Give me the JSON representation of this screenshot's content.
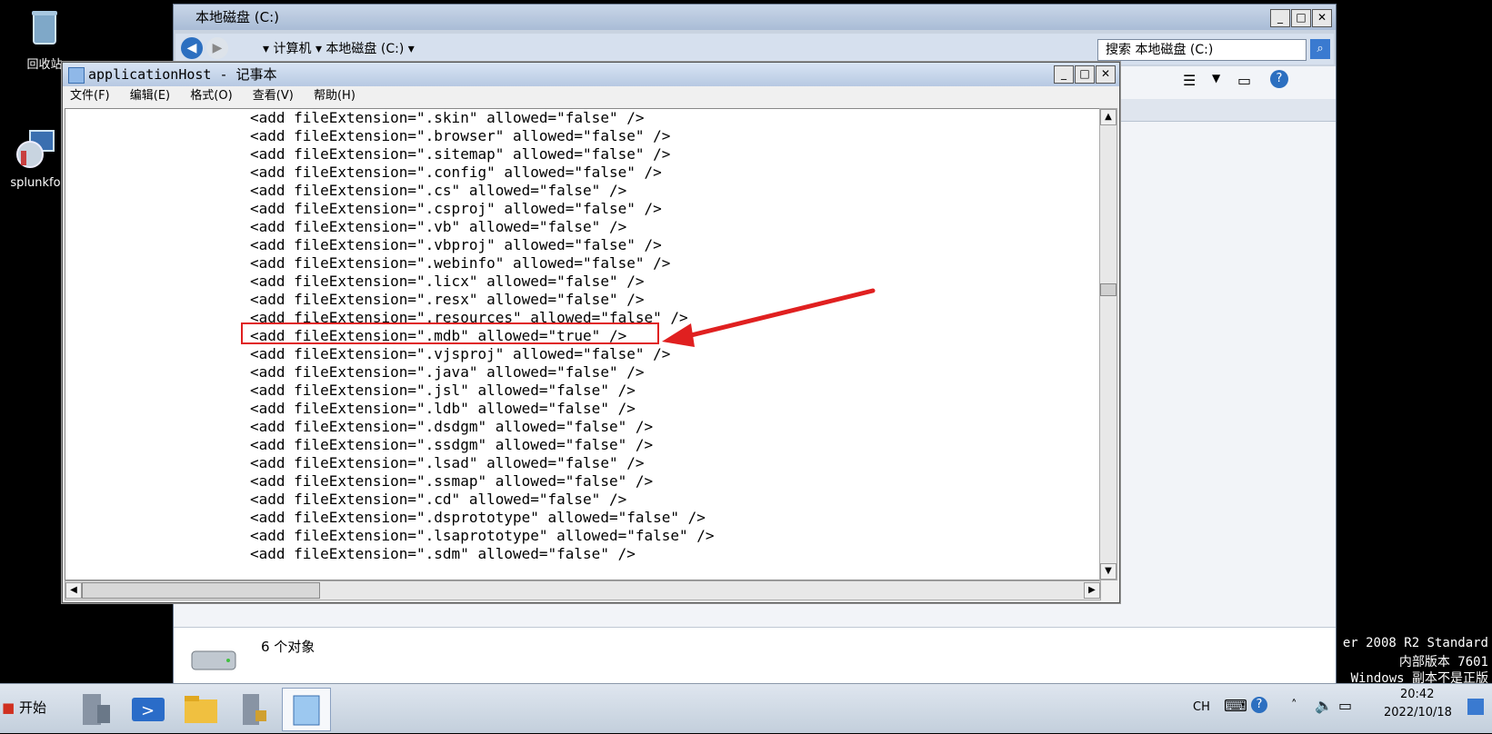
{
  "desktop": {
    "icons": [
      {
        "label": "回收站"
      },
      {
        "label": "splunkfo"
      }
    ]
  },
  "explorer": {
    "title": "本地磁盘 (C:)",
    "breadcrumb": [
      "计算机",
      "本地磁盘 (C:)"
    ],
    "search_placeholder": "搜索 本地磁盘 (C:)",
    "status_text": "6 个对象"
  },
  "notepad": {
    "title": "applicationHost - 记事本",
    "menu": [
      "文件(F)",
      "编辑(E)",
      "格式(O)",
      "查看(V)",
      "帮助(H)"
    ],
    "lines": [
      "<add fileExtension=\".skin\" allowed=\"false\" />",
      "<add fileExtension=\".browser\" allowed=\"false\" />",
      "<add fileExtension=\".sitemap\" allowed=\"false\" />",
      "<add fileExtension=\".config\" allowed=\"false\" />",
      "<add fileExtension=\".cs\" allowed=\"false\" />",
      "<add fileExtension=\".csproj\" allowed=\"false\" />",
      "<add fileExtension=\".vb\" allowed=\"false\" />",
      "<add fileExtension=\".vbproj\" allowed=\"false\" />",
      "<add fileExtension=\".webinfo\" allowed=\"false\" />",
      "<add fileExtension=\".licx\" allowed=\"false\" />",
      "<add fileExtension=\".resx\" allowed=\"false\" />",
      "<add fileExtension=\".resources\" allowed=\"false\" />",
      "<add fileExtension=\".mdb\" allowed=\"true\" />",
      "<add fileExtension=\".vjsproj\" allowed=\"false\" />",
      "<add fileExtension=\".java\" allowed=\"false\" />",
      "<add fileExtension=\".jsl\" allowed=\"false\" />",
      "<add fileExtension=\".ldb\" allowed=\"false\" />",
      "<add fileExtension=\".dsdgm\" allowed=\"false\" />",
      "<add fileExtension=\".ssdgm\" allowed=\"false\" />",
      "<add fileExtension=\".lsad\" allowed=\"false\" />",
      "<add fileExtension=\".ssmap\" allowed=\"false\" />",
      "<add fileExtension=\".cd\" allowed=\"false\" />",
      "<add fileExtension=\".dsprototype\" allowed=\"false\" />",
      "<add fileExtension=\".lsaprototype\" allowed=\"false\" />",
      "<add fileExtension=\".sdm\" allowed=\"false\" />"
    ]
  },
  "desktop_watermark": {
    "line1": "er 2008 R2 Standard",
    "line2": "内部版本 7601",
    "line3": "Windows 副本不是正版"
  },
  "taskbar": {
    "start_label": "开始",
    "lang": "CH",
    "time": "20:42",
    "date": "2022/10/18"
  },
  "colors": {
    "highlight": "#e02020",
    "arrow": "#e02020"
  }
}
